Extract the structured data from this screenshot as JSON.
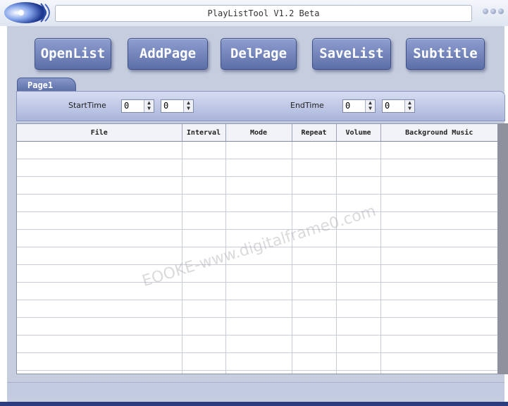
{
  "window": {
    "title": "PlayListTool V1.2 Beta"
  },
  "toolbar": {
    "buttons": [
      {
        "label": "OpenList"
      },
      {
        "label": "AddPage"
      },
      {
        "label": "DelPage"
      },
      {
        "label": "SaveList"
      },
      {
        "label": "Subtitle"
      }
    ]
  },
  "tabs": [
    {
      "label": "Page1",
      "active": true
    }
  ],
  "time_controls": {
    "start_label": "StartTime",
    "start_values": [
      "0",
      "0"
    ],
    "end_label": "EndTime",
    "end_values": [
      "0",
      "0"
    ]
  },
  "table": {
    "columns": [
      "File",
      "Interval",
      "Mode",
      "Repeat",
      "Volume",
      "Background Music"
    ],
    "rows": []
  },
  "watermark": "EOOKE-www.digitalframe0.com",
  "colors": {
    "button": "#6d7db8",
    "panel": "#c5cddf",
    "accent": "#2b3d7e"
  }
}
